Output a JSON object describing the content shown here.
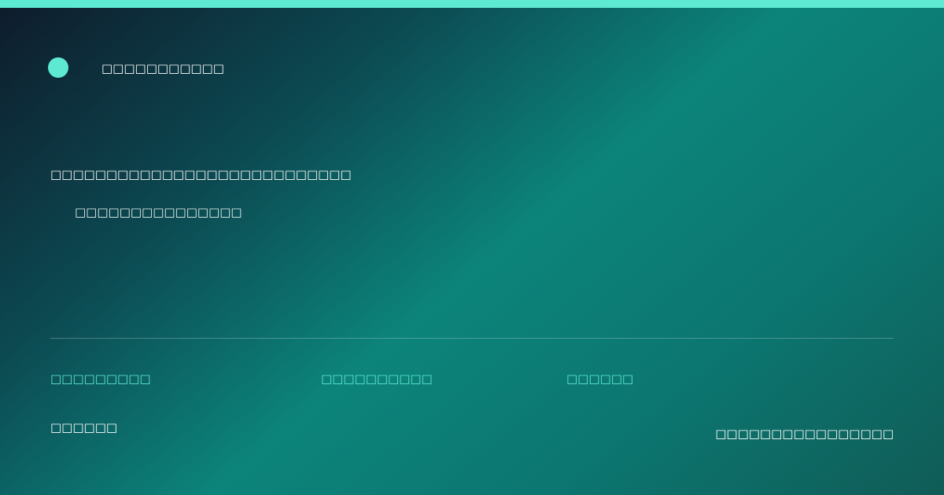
{
  "colors": {
    "accent": "#5ee9d2",
    "text": "#ffffff"
  },
  "header": {
    "brand_icon": "circle-dot",
    "brand_name": "□□□□□□□□□□□"
  },
  "hero": {
    "headline": "□□□□□□□□□□□□□□□□□□□□□□□□□□□",
    "subline": "□□□□□□□□□□□□□□□"
  },
  "meta": {
    "items": [
      {
        "label": "□□□□□□□□□"
      },
      {
        "label": "□□□□□□□□□□"
      },
      {
        "label": "□□□□□□"
      }
    ]
  },
  "footer": {
    "left": "□□□□□□",
    "right": "□□□□□□□□□□□□□□□□"
  }
}
